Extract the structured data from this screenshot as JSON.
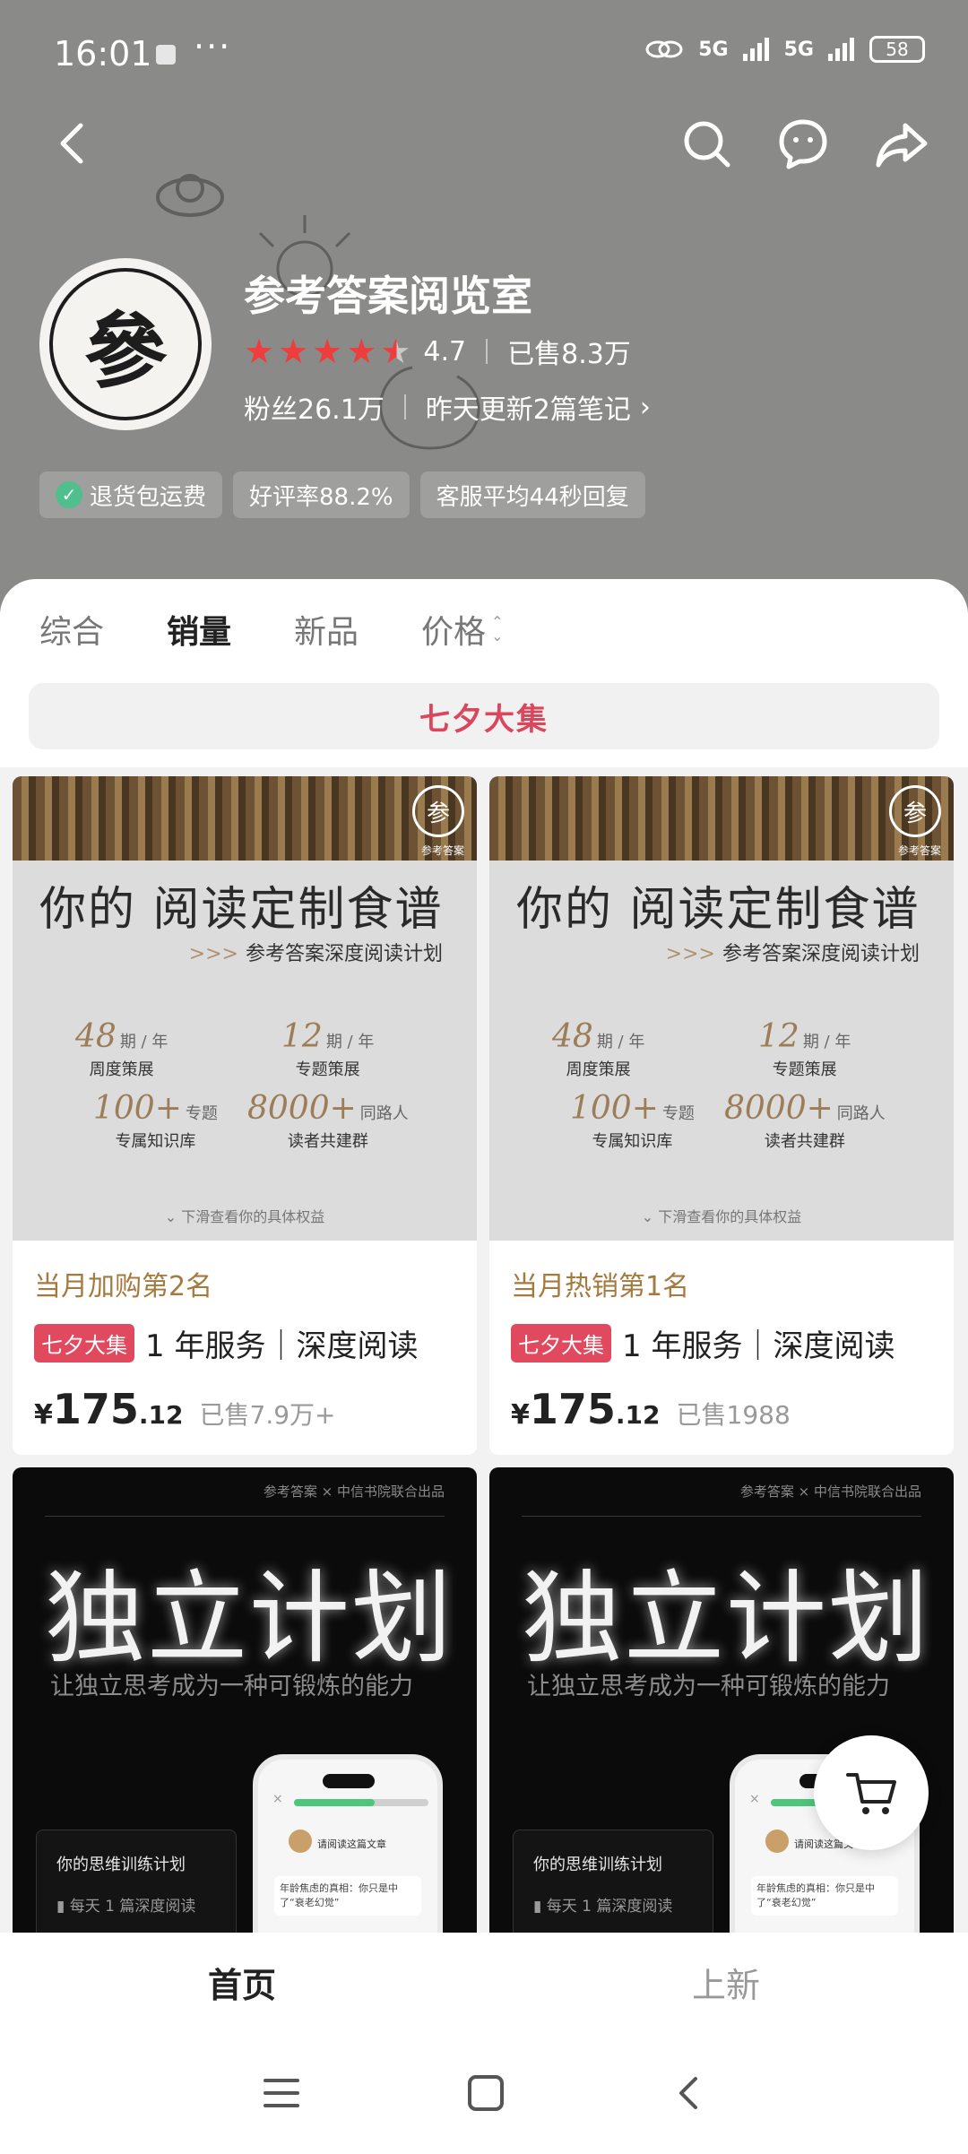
{
  "status_bar": {
    "time": "16:01",
    "dots": "···",
    "signal1": "5G",
    "signal2": "5G",
    "battery": "58"
  },
  "shop": {
    "logo_char": "參",
    "name": "参考答案阅览室",
    "rating": "4.7",
    "rating_value": 4.7,
    "sold": "已售8.3万",
    "fans": "粉丝26.1万",
    "updates": "昨天更新2篇笔记"
  },
  "badges": [
    "退货包运费",
    "好评率88.2%",
    "客服平均44秒回复"
  ],
  "tabs": [
    "综合",
    "销量",
    "新品",
    "价格"
  ],
  "promo_bar": "七夕大集",
  "products": [
    {
      "image": {
        "title": "你的 阅读定制食谱",
        "subtitle": "参考答案深度阅读计划",
        "logo": "参",
        "logo_text": "参考答案",
        "stats": [
          {
            "num": "48",
            "unit": "期 / 年",
            "label": "周度策展"
          },
          {
            "num": "12",
            "unit": "期 / 年",
            "label": "专题策展"
          },
          {
            "num": "100+",
            "unit": "专题",
            "label": "专属知识库"
          },
          {
            "num": "8000+",
            "unit": "同路人",
            "label": "读者共建群"
          }
        ],
        "footer": "下滑查看你的具体权益"
      },
      "rank": "当月加购第2名",
      "tag": "七夕大集",
      "title": "1 年服务｜深度阅读",
      "currency": "¥",
      "price_int": "175",
      "price_dec": ".12",
      "sold": "已售7.9万+"
    },
    {
      "image": {
        "title": "你的 阅读定制食谱",
        "subtitle": "参考答案深度阅读计划",
        "logo": "参",
        "logo_text": "参考答案",
        "stats": [
          {
            "num": "48",
            "unit": "期 / 年",
            "label": "周度策展"
          },
          {
            "num": "12",
            "unit": "期 / 年",
            "label": "专题策展"
          },
          {
            "num": "100+",
            "unit": "专题",
            "label": "专属知识库"
          },
          {
            "num": "8000+",
            "unit": "同路人",
            "label": "读者共建群"
          }
        ],
        "footer": "下滑查看你的具体权益"
      },
      "rank": "当月热销第1名",
      "tag": "七夕大集",
      "title": "1 年服务｜深度阅读",
      "currency": "¥",
      "price_int": "175",
      "price_dec": ".12",
      "sold": "已售1988"
    },
    {
      "image": {
        "top_text": "参考答案 × 中信书院联合出品",
        "title": "独立计划",
        "subtitle": "让独立思考成为一种可锻炼的能力",
        "phone_head": "请阅读这篇文章",
        "phone_text": "年龄焦虑的真相：你只是中了“衰老幻觉”",
        "phone_close": "×",
        "plan_title": "你的思维训练计划",
        "plan_line": "每天 1 篇深度阅读"
      }
    },
    {
      "image": {
        "top_text": "参考答案 × 中信书院联合出品",
        "title": "独立计划",
        "subtitle": "让独立思考成为一种可锻炼的能力",
        "phone_head": "请阅读这篇文章",
        "phone_text": "年龄焦虑的真相：你只是中了“衰老幻觉”",
        "phone_close": "×",
        "plan_title": "你的思维训练计划",
        "plan_line": "每天 1 篇深度阅读"
      }
    }
  ],
  "bottom_tabs": [
    "首页",
    "上新"
  ],
  "icons": {
    "back": "back-arrow-icon",
    "search": "search-icon",
    "chat": "chat-icon",
    "share": "share-icon",
    "cart": "cart-icon"
  },
  "colors": {
    "header_bg": "#8a8a88",
    "accent_red": "#e0495e",
    "rank_gold": "#a57a3f",
    "star_red": "#ef3c3c"
  }
}
